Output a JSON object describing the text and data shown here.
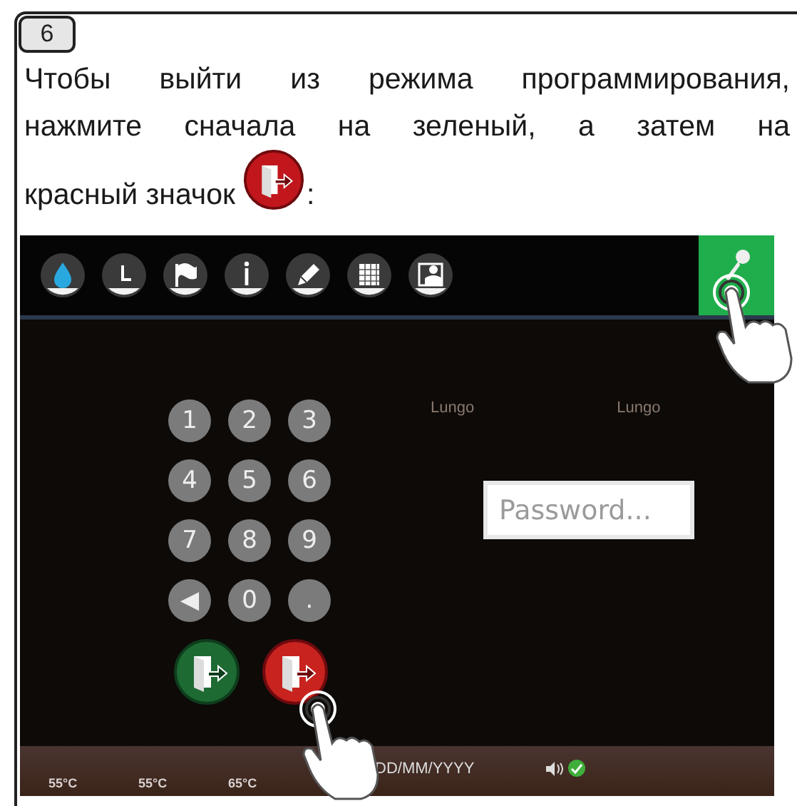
{
  "step": {
    "number": "6",
    "instruction_lines": [
      "Чтобы выйти из режима программирования,",
      "нажмите сначала на зеленый, а затем на",
      "красный значок"
    ],
    "instruction_end": ":"
  },
  "screen": {
    "drink_labels": [
      "Lungo",
      "Lungo"
    ],
    "keypad": {
      "keys": [
        "1",
        "2",
        "3",
        "4",
        "5",
        "6",
        "7",
        "8",
        "9",
        "◀",
        "0",
        "."
      ]
    },
    "password_field": {
      "placeholder": "Password..."
    },
    "status_bar": {
      "temperatures": [
        "55°C",
        "55°C",
        "65°C"
      ],
      "date": "DD/MM/YYYY"
    }
  }
}
